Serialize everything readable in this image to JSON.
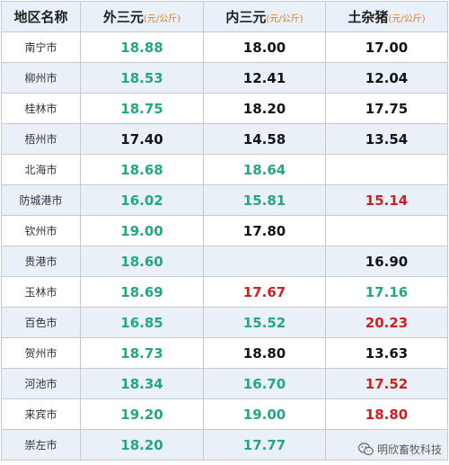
{
  "header": {
    "region": "地区名称",
    "col_outer": {
      "label": "外三元",
      "unit": "(元/公斤)"
    },
    "col_inner": {
      "label": "内三元",
      "unit": "(元/公斤)"
    },
    "col_local": {
      "label": "土杂猪",
      "unit": "(元/公斤)"
    }
  },
  "colors": {
    "green": "#22a785",
    "black": "#151515",
    "red": "#d11f1f",
    "header_bg": "#e8f0f9",
    "stripe_bg": "#eaf0f8"
  },
  "rows": [
    {
      "city": "南宁市",
      "outer": "18.88",
      "outer_c": "green",
      "inner": "18.00",
      "inner_c": "black",
      "local": "17.00",
      "local_c": "black"
    },
    {
      "city": "柳州市",
      "outer": "18.53",
      "outer_c": "green",
      "inner": "12.41",
      "inner_c": "black",
      "local": "12.04",
      "local_c": "black"
    },
    {
      "city": "桂林市",
      "outer": "18.75",
      "outer_c": "green",
      "inner": "18.20",
      "inner_c": "black",
      "local": "17.75",
      "local_c": "black"
    },
    {
      "city": "梧州市",
      "outer": "17.40",
      "outer_c": "black",
      "inner": "14.58",
      "inner_c": "black",
      "local": "13.54",
      "local_c": "black"
    },
    {
      "city": "北海市",
      "outer": "18.68",
      "outer_c": "green",
      "inner": "18.64",
      "inner_c": "green",
      "local": "",
      "local_c": "black"
    },
    {
      "city": "防城港市",
      "outer": "16.02",
      "outer_c": "green",
      "inner": "15.81",
      "inner_c": "green",
      "local": "15.14",
      "local_c": "red"
    },
    {
      "city": "钦州市",
      "outer": "19.00",
      "outer_c": "green",
      "inner": "17.80",
      "inner_c": "black",
      "local": "",
      "local_c": "black"
    },
    {
      "city": "贵港市",
      "outer": "18.60",
      "outer_c": "green",
      "inner": "",
      "inner_c": "black",
      "local": "16.90",
      "local_c": "black"
    },
    {
      "city": "玉林市",
      "outer": "18.69",
      "outer_c": "green",
      "inner": "17.67",
      "inner_c": "red",
      "local": "17.16",
      "local_c": "green"
    },
    {
      "city": "百色市",
      "outer": "16.85",
      "outer_c": "green",
      "inner": "15.52",
      "inner_c": "green",
      "local": "20.23",
      "local_c": "red"
    },
    {
      "city": "贺州市",
      "outer": "18.73",
      "outer_c": "green",
      "inner": "18.80",
      "inner_c": "black",
      "local": "13.63",
      "local_c": "black"
    },
    {
      "city": "河池市",
      "outer": "18.34",
      "outer_c": "green",
      "inner": "16.70",
      "inner_c": "green",
      "local": "17.52",
      "local_c": "red"
    },
    {
      "city": "来宾市",
      "outer": "19.20",
      "outer_c": "green",
      "inner": "19.00",
      "inner_c": "green",
      "local": "18.80",
      "local_c": "red"
    },
    {
      "city": "崇左市",
      "outer": "18.20",
      "outer_c": "green",
      "inner": "17.77",
      "inner_c": "green",
      "local": "",
      "local_c": "red"
    }
  ],
  "watermark": {
    "text": "明欣畜牧科技",
    "icon": "wechat-logo-icon"
  }
}
